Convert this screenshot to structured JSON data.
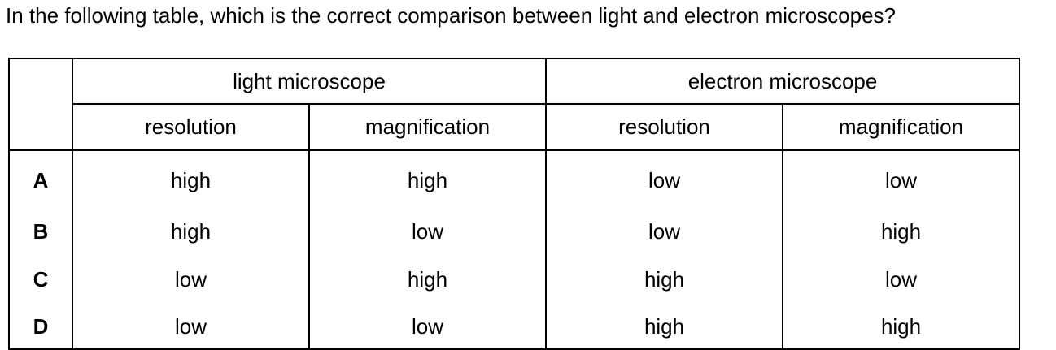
{
  "question": "In the following table, which is the correct comparison between light and electron microscopes?",
  "table": {
    "group_headers": [
      "light microscope",
      "electron microscope"
    ],
    "sub_headers": [
      "resolution",
      "magnification",
      "resolution",
      "magnification"
    ],
    "rows": [
      {
        "key": "A",
        "cells": [
          "high",
          "high",
          "low",
          "low"
        ]
      },
      {
        "key": "B",
        "cells": [
          "high",
          "low",
          "low",
          "high"
        ]
      },
      {
        "key": "C",
        "cells": [
          "low",
          "high",
          "high",
          "low"
        ]
      },
      {
        "key": "D",
        "cells": [
          "low",
          "low",
          "high",
          "high"
        ]
      }
    ]
  }
}
